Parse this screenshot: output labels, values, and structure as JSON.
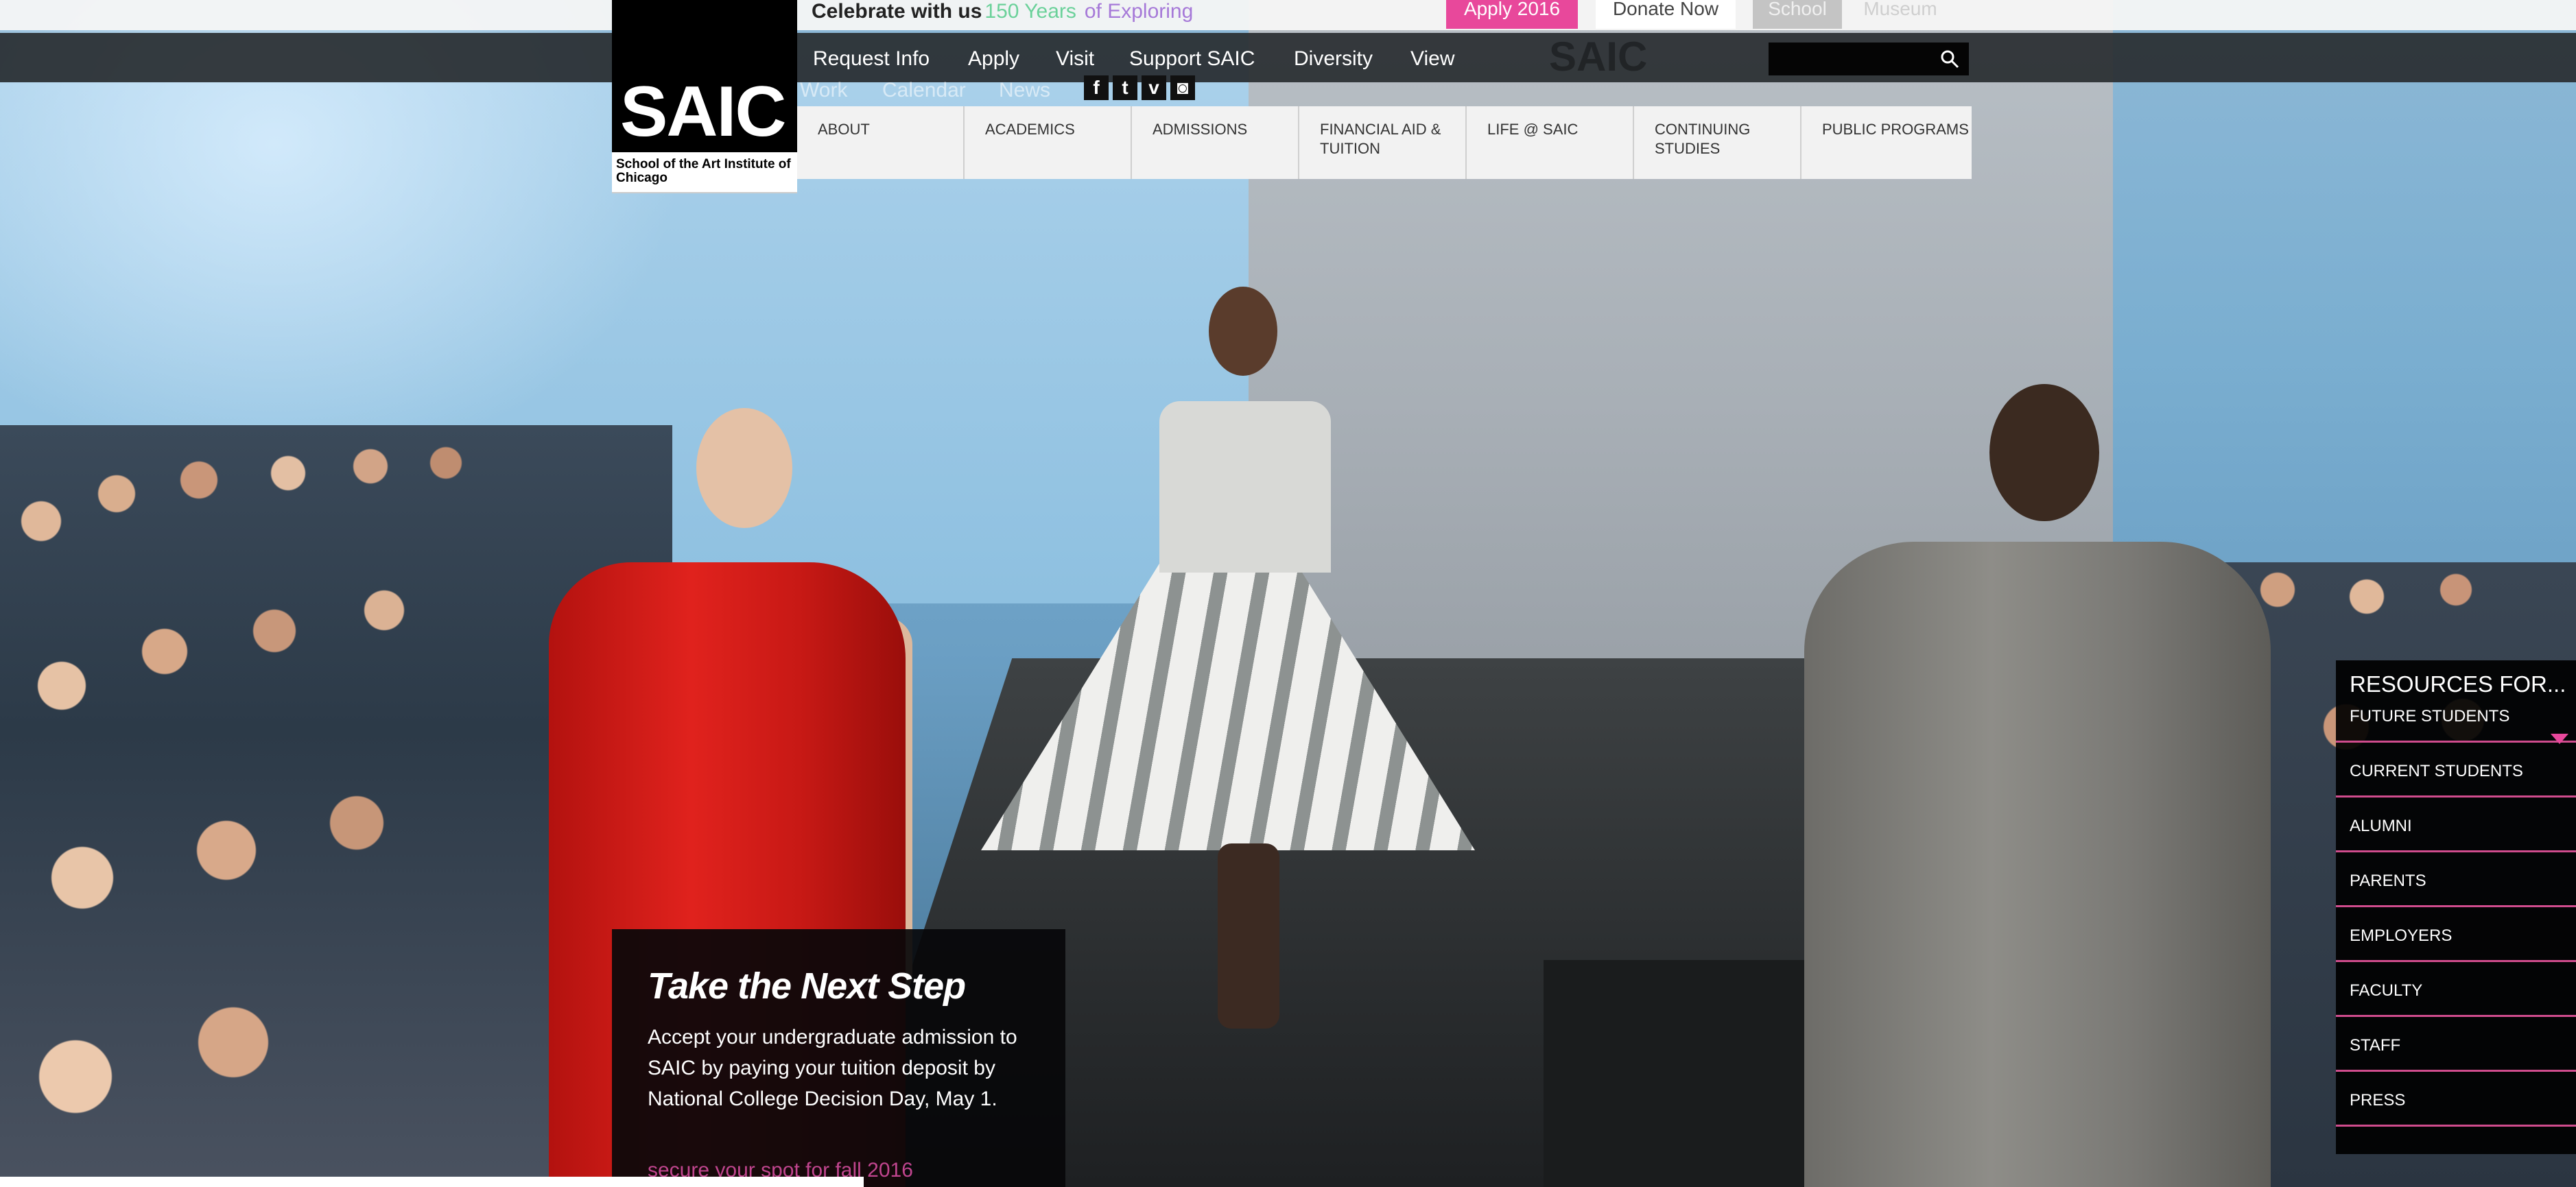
{
  "utility_bar": {
    "celebrate_prefix": "Celebrate with us",
    "celebrate_years": "150 Years",
    "celebrate_explore": "of Exploring",
    "apply": "Apply 2016",
    "donate": "Donate Now",
    "school": "School",
    "museum": "Museum"
  },
  "main_nav": {
    "items": [
      "Request Info",
      "Apply",
      "Visit",
      "Support SAIC",
      "Diversity",
      "View"
    ],
    "ghost_links": [
      "Work",
      "Calendar",
      "News"
    ],
    "ghost_logo": "SAIC"
  },
  "social": {
    "facebook": "f",
    "twitter": "t",
    "vimeo": "v",
    "instagram": "◙"
  },
  "logo": {
    "mark": "SAIC",
    "subtitle": "School of the Art Institute of Chicago"
  },
  "primary_menu": {
    "items": [
      "ABOUT",
      "ACADEMICS",
      "ADMISSIONS",
      "FINANCIAL AID & TUITION",
      "LIFE @ SAIC",
      "CONTINUING STUDIES",
      "PUBLIC PROGRAMS"
    ]
  },
  "next_step": {
    "title": "Take the Next Step",
    "body": "Accept your undergraduate admission to SAIC by paying your tuition deposit by National College Decision Day, May 1.",
    "link": "secure your spot for fall 2016"
  },
  "resources": {
    "title": "RESOURCES FOR...",
    "items": [
      "FUTURE STUDENTS",
      "CURRENT STUDENTS",
      "ALUMNI",
      "PARENTS",
      "EMPLOYERS",
      "FACULTY",
      "STAFF",
      "PRESS"
    ]
  },
  "colors": {
    "accent_pink": "#e8489b",
    "years_green": "#6bd19a",
    "explore_purple": "#a679d8"
  }
}
